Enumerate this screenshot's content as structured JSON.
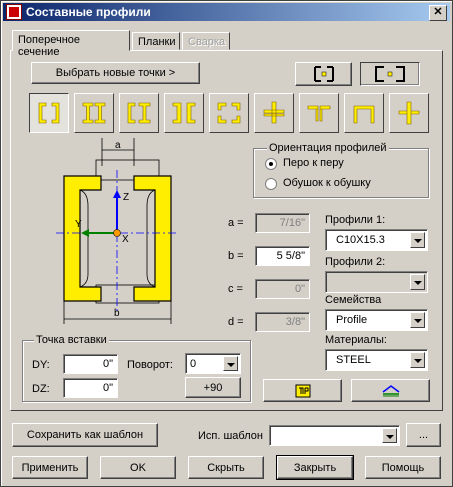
{
  "window": {
    "title": "Составные профили"
  },
  "tabs": [
    {
      "label": "Поперечное сечение"
    },
    {
      "label": "Планки"
    },
    {
      "label": "Сварка"
    }
  ],
  "select_points_label": "Выбрать новые точки >",
  "diagram": {
    "dim_a": "a",
    "dim_b": "b",
    "axis_z": "Z",
    "axis_y": "Y",
    "axis_x": "X"
  },
  "orientation": {
    "title": "Ориентация профилей",
    "options": [
      {
        "label": "Перо к перу",
        "selected": true
      },
      {
        "label": "Обушок к обушку",
        "selected": false
      }
    ]
  },
  "dimensions": [
    {
      "name": "a =",
      "value": "7/16\"",
      "enabled": false
    },
    {
      "name": "b =",
      "value": "5 5/8\"",
      "enabled": true
    },
    {
      "name": "c =",
      "value": "0\"",
      "enabled": false
    },
    {
      "name": "d =",
      "value": "3/8\"",
      "enabled": false
    }
  ],
  "profiles1": {
    "label": "Профили 1:",
    "value": "C10X15.3"
  },
  "profiles2": {
    "label": "Профили 2:",
    "value": ""
  },
  "family": {
    "label": "Семейства",
    "value": "Profile"
  },
  "materials": {
    "label": "Материалы:",
    "value": "STEEL"
  },
  "insert_point": {
    "title": "Точка вставки",
    "dy_label": "DY:",
    "dy_value": "0\"",
    "dz_label": "DZ:",
    "dz_value": "0\"",
    "rotation_label": "Поворот:",
    "rotation_value": "0",
    "rotate_button": "+90"
  },
  "save_template_label": "Сохранить как шаблон",
  "use_template_label": "Исп. шаблон",
  "use_template_value": "",
  "browse_label": "...",
  "buttons": {
    "apply": "Применить",
    "ok": "OK",
    "hide": "Скрыть",
    "close": "Закрыть",
    "help": "Помощь"
  },
  "colors": {
    "profile_yellow": "#ffee00",
    "axis_blue": "#0000ff",
    "axis_green": "#008000",
    "titlebar": "#0a246a"
  }
}
